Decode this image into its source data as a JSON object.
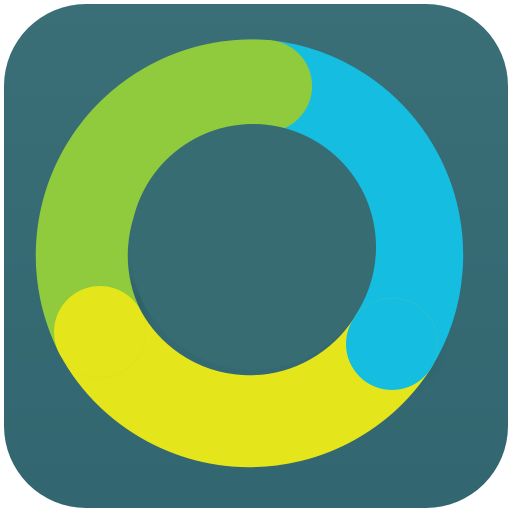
{
  "icon": {
    "name": "ring-logo-icon",
    "colors": {
      "background": "#376C73",
      "background_edge": "#2F5F67",
      "green": "#8FCB3C",
      "cyan": "#15BDE0",
      "yellow": "#E5E51C",
      "shadow": "#1E4A52"
    },
    "segments": [
      "green",
      "cyan",
      "yellow"
    ]
  }
}
